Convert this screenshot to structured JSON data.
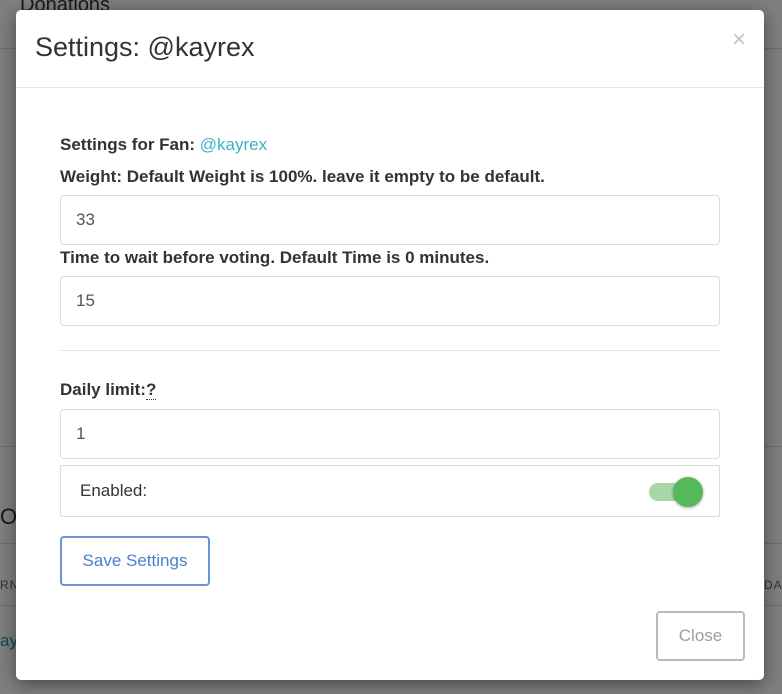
{
  "background": {
    "title_fragment": "Donations",
    "left_fragment_1": "OV",
    "left_fragment_2": "RN",
    "left_fragment_3": "ay",
    "right_fragment_1": "DAI"
  },
  "modal": {
    "title": "Settings: @kayrex",
    "close_icon_glyph": "×",
    "fan": {
      "label": "Settings for Fan:",
      "handle": "@kayrex"
    },
    "weight": {
      "label": "Weight: Default Weight is 100%. leave it empty to be default.",
      "value": "33"
    },
    "wait_time": {
      "label": "Time to wait before voting. Default Time is 0 minutes.",
      "value": "15"
    },
    "daily_limit": {
      "label": "Daily limit:",
      "help": "?",
      "value": "1"
    },
    "enabled": {
      "label": "Enabled:",
      "on": true
    },
    "save_button": "Save Settings",
    "close_button": "Close"
  },
  "colors": {
    "accent_link": "#3bb3c3",
    "save_button": "#4a7fcd",
    "toggle_on": "#55b95a"
  }
}
